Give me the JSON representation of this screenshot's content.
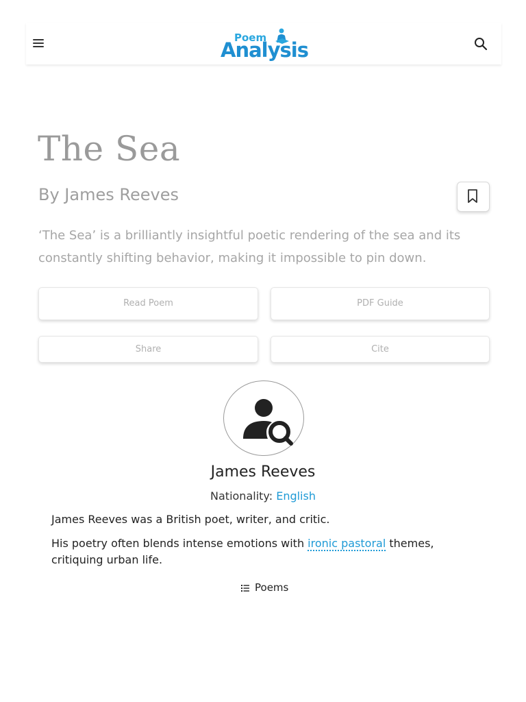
{
  "header": {
    "logo_top": "Poem",
    "logo_bottom": "Analysis",
    "colors": {
      "logo": "#1f8fd1",
      "accent": "#1e9ad6"
    },
    "icons": {
      "menu": "hamburger-menu-icon",
      "search": "search-icon"
    }
  },
  "poem": {
    "title": "The Sea",
    "author_line": "By James Reeves",
    "summary": "‘The Sea’ is a brilliantly insightful poetic rendering of the sea and its constantly shifting behavior, making it impossible to pin down."
  },
  "actions": {
    "read_poem": "Read Poem",
    "pdf_guide": "PDF Guide",
    "share": "Share",
    "cite": "Cite"
  },
  "poet": {
    "name": "James Reeves",
    "nationality_label": "Nationality:",
    "nationality_value": "English",
    "bio_1": "James Reeves was a British poet, writer, and critic.",
    "bio_2_pre": "His poetry often blends intense emotions with ",
    "bio_2_link": "ironic pastoral",
    "bio_2_post": " themes, critiquing urban life.",
    "poems_link": "Poems"
  }
}
